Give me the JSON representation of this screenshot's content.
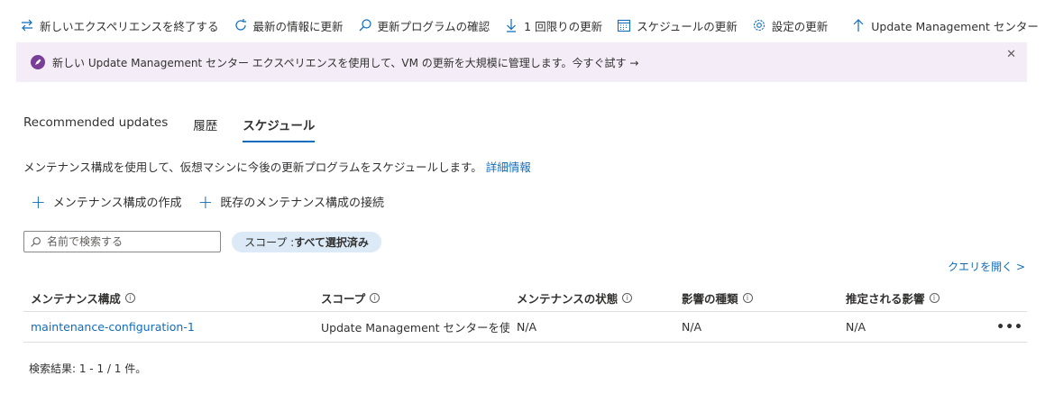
{
  "toolbar": {
    "items": [
      {
        "label": "新しいエクスペリエンスを終了する",
        "icon": "switch-arrows-icon"
      },
      {
        "label": "最新の情報に更新",
        "icon": "refresh-icon"
      },
      {
        "label": "更新プログラムの確認",
        "icon": "search-icon"
      },
      {
        "label": "1 回限りの更新",
        "icon": "download-arrow-icon"
      },
      {
        "label": "スケジュールの更新",
        "icon": "calendar-icon"
      },
      {
        "label": "設定の更新",
        "icon": "gear-icon"
      },
      {
        "label": "Update Management センター",
        "icon": "up-arrow-icon"
      }
    ],
    "more": "···"
  },
  "banner": {
    "text": "新しい Update Management センター エクスペリエンスを使用して、VM の更新を大規模に管理します。今すぐ試す →",
    "close": "✕",
    "accent": "#7a3d98"
  },
  "tabs": [
    {
      "label": "Recommended updates",
      "active": false
    },
    {
      "label": "履歴",
      "active": false
    },
    {
      "label": "スケジュール",
      "active": true
    }
  ],
  "description": {
    "text": "メンテナンス構成を使用して、仮想マシンに今後の更新プログラムをスケジュールします。",
    "link": "詳細情報"
  },
  "actions": {
    "create": "メンテナンス構成の作成",
    "attach": "既存のメンテナンス構成の接続"
  },
  "search": {
    "placeholder": "名前で検索する",
    "value": ""
  },
  "scope_pill": {
    "prefix": "スコープ : ",
    "value": "すべて選択済み"
  },
  "query_link": "クエリを開く >",
  "grid": {
    "columns": [
      "メンテナンス構成",
      "スコープ",
      "メンテナンスの状態",
      "影響の種類",
      "推定される影響"
    ],
    "rows": [
      {
        "name": "maintenance-configuration-1",
        "scope": "Update Management センターを使…",
        "status": "N/A",
        "impact_type": "N/A",
        "estimated_impact": "N/A",
        "more": "•••"
      }
    ]
  },
  "results": "検索結果: 1 - 1 / 1 件。",
  "colors": {
    "link": "#0f6cbd",
    "banner_bg": "#f4ecf6",
    "pill_bg": "#dceaf7"
  }
}
